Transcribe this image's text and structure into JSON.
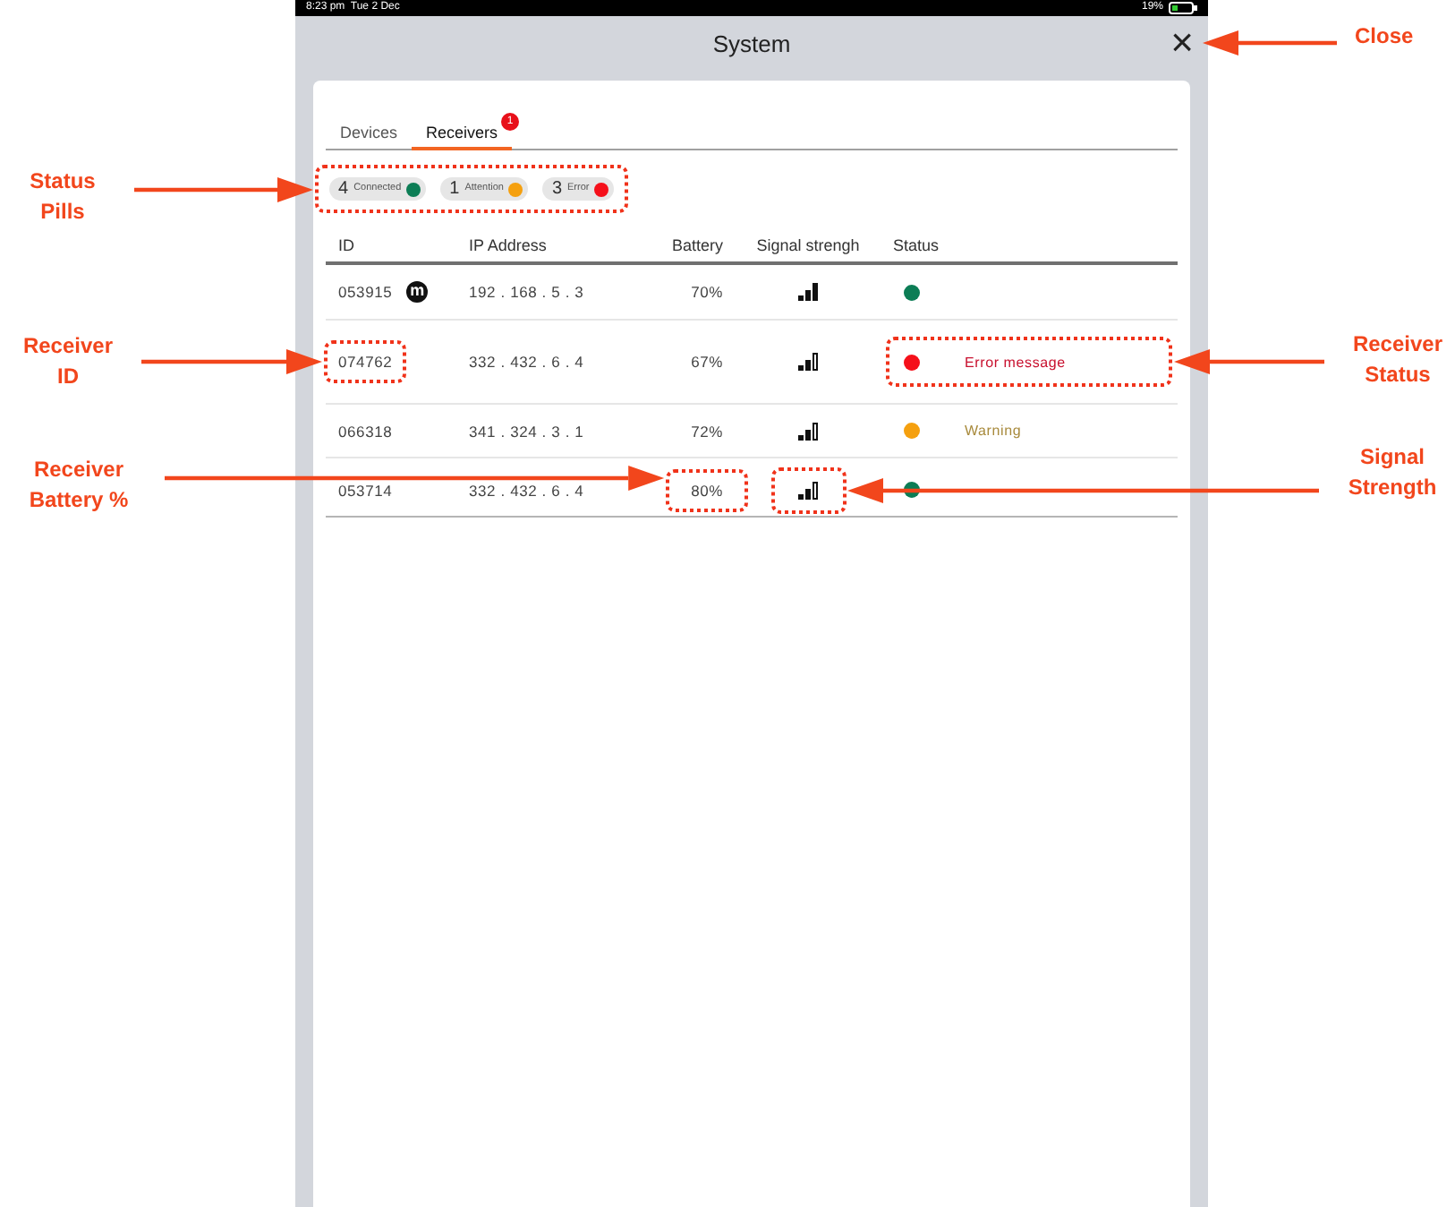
{
  "status_bar": {
    "time": "8:23 pm  Tue 2 Dec",
    "battery": "19%"
  },
  "window": {
    "title": "System",
    "close": "×"
  },
  "tabs": [
    {
      "label": "Devices",
      "selected": false
    },
    {
      "label": "Receivers",
      "selected": true,
      "badge": "1"
    }
  ],
  "pills": [
    {
      "count": "4",
      "label": "Connected",
      "color": "#0c7d55"
    },
    {
      "count": "1",
      "label": "Attention",
      "color": "#f5a00f"
    },
    {
      "count": "3",
      "label": "Error",
      "color": "#f5101a"
    }
  ],
  "table": {
    "columns": [
      "ID",
      "IP Address",
      "Battery",
      "Signal strengh",
      "Status"
    ],
    "rows": [
      {
        "id": "053915",
        "tag": "m",
        "ip": "192 . 168 . 5 . 3",
        "battery": "70%",
        "signal_full": true,
        "color": "#0c7d55"
      },
      {
        "id": "074762",
        "ip": "332 . 432 . 6 . 4",
        "battery": "67%",
        "signal_full": false,
        "color": "#f5101a",
        "message": {
          "text": "Error message",
          "kind": "error"
        }
      },
      {
        "id": "066318",
        "ip": "341 . 324 . 3 . 1",
        "battery": "72%",
        "signal_full": false,
        "color": "#f5a00f",
        "message": {
          "text": "Warning",
          "kind": "warning"
        }
      },
      {
        "id": "053714",
        "ip": "332 . 432 . 6 . 4",
        "battery": "80%",
        "signal_full": false,
        "color": "#0c7d55"
      }
    ]
  },
  "annotations": [
    {
      "label": "Close",
      "kind": "close",
      "boxed": false
    },
    {
      "label": "Status Pills",
      "kind": "pills",
      "boxed": true
    },
    {
      "label": "Receiver ID",
      "kind": "receiver_id",
      "boxed": true
    },
    {
      "label": "Receiver Status",
      "kind": "status",
      "boxed": true
    },
    {
      "label": "Receiver Battery %",
      "kind": "battery",
      "boxed": true
    },
    {
      "label": "Signal Strength",
      "kind": "signal",
      "boxed": true
    }
  ]
}
